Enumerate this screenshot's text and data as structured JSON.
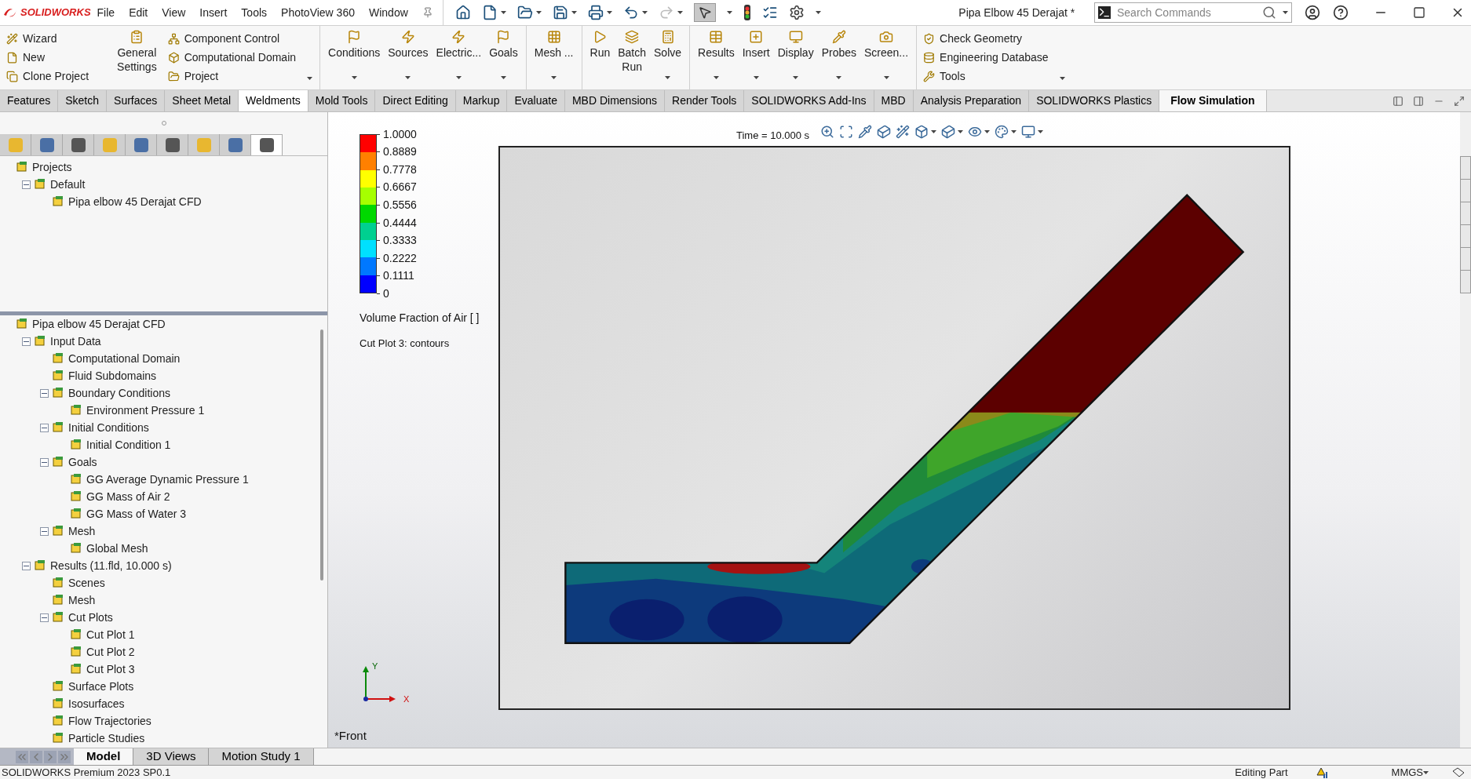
{
  "app": {
    "logo": "SOLIDWORKS",
    "menu": [
      "File",
      "Edit",
      "View",
      "Insert",
      "Tools",
      "PhotoView 360",
      "Window"
    ],
    "title": "Pipa Elbow 45 Derajat *",
    "search": {
      "placeholder": "Search Commands"
    }
  },
  "ribbon": {
    "sections": [
      {
        "groups": [
          {
            "kind": "small",
            "dropdown": false,
            "items": [
              {
                "label": "Wizard"
              },
              {
                "label": "New"
              },
              {
                "label": "Clone Project"
              }
            ]
          },
          {
            "kind": "large",
            "items": [
              {
                "label": "General\nSettings",
                "dropdown": false
              }
            ]
          },
          {
            "kind": "small",
            "dropdown": true,
            "items": [
              {
                "label": "Component Control"
              },
              {
                "label": "Computational Domain"
              },
              {
                "label": "Project"
              }
            ]
          }
        ]
      },
      {
        "groups": [
          {
            "kind": "large",
            "items": [
              {
                "label": "Conditions",
                "dropdown": true
              },
              {
                "label": "Sources",
                "dropdown": true
              },
              {
                "label": "Electric...",
                "dropdown": true
              },
              {
                "label": "Goals",
                "dropdown": true
              }
            ]
          }
        ]
      },
      {
        "groups": [
          {
            "kind": "large",
            "items": [
              {
                "label": "Mesh ...",
                "dropdown": true
              }
            ]
          }
        ]
      },
      {
        "groups": [
          {
            "kind": "large",
            "items": [
              {
                "label": "Run",
                "dropdown": false
              },
              {
                "label": "Batch\nRun",
                "dropdown": false
              },
              {
                "label": "Solve",
                "dropdown": true
              }
            ]
          }
        ]
      },
      {
        "groups": [
          {
            "kind": "large",
            "items": [
              {
                "label": "Results",
                "dropdown": true
              },
              {
                "label": "Insert",
                "dropdown": true
              },
              {
                "label": "Display",
                "dropdown": true
              },
              {
                "label": "Probes",
                "dropdown": true
              },
              {
                "label": "Screen...",
                "dropdown": true
              }
            ]
          }
        ]
      },
      {
        "groups": [
          {
            "kind": "small",
            "dropdown": true,
            "items": [
              {
                "label": "Check Geometry"
              },
              {
                "label": "Engineering Database"
              },
              {
                "label": "Tools"
              }
            ]
          }
        ]
      }
    ]
  },
  "tabs": [
    {
      "label": "Features",
      "selected": false,
      "hovered": false
    },
    {
      "label": "Sketch",
      "selected": false,
      "hovered": false
    },
    {
      "label": "Surfaces",
      "selected": false,
      "hovered": false
    },
    {
      "label": "Sheet Metal",
      "selected": false,
      "hovered": false
    },
    {
      "label": "Weldments",
      "selected": false,
      "hovered": true
    },
    {
      "label": "Mold Tools",
      "selected": false,
      "hovered": false
    },
    {
      "label": "Direct Editing",
      "selected": false,
      "hovered": false
    },
    {
      "label": "Markup",
      "selected": false,
      "hovered": false
    },
    {
      "label": "Evaluate",
      "selected": false,
      "hovered": false
    },
    {
      "label": "MBD Dimensions",
      "selected": false,
      "hovered": false
    },
    {
      "label": "Render Tools",
      "selected": false,
      "hovered": false
    },
    {
      "label": "SOLIDWORKS Add-Ins",
      "selected": false,
      "hovered": false
    },
    {
      "label": "MBD",
      "selected": false,
      "hovered": false
    },
    {
      "label": "Analysis Preparation",
      "selected": false,
      "hovered": false
    },
    {
      "label": "SOLIDWORKS Plastics",
      "selected": false,
      "hovered": false
    },
    {
      "label": "Flow Simulation",
      "selected": true,
      "hovered": false
    }
  ],
  "panel_tabs": [
    {
      "selected": false
    },
    {
      "selected": false
    },
    {
      "selected": false
    },
    {
      "selected": false
    },
    {
      "selected": false
    },
    {
      "selected": false
    },
    {
      "selected": false
    },
    {
      "selected": false
    },
    {
      "selected": true
    }
  ],
  "project_tree": [
    {
      "label": "Projects",
      "children": [
        {
          "label": "Default",
          "expanded": true,
          "children": [
            {
              "label": "Pipa elbow 45 Derajat CFD"
            }
          ]
        }
      ]
    }
  ],
  "analysis_tree": {
    "label": "Pipa elbow 45 Derajat CFD",
    "children": [
      {
        "label": "Input Data",
        "expanded": true,
        "children": [
          {
            "label": "Computational Domain"
          },
          {
            "label": "Fluid Subdomains"
          },
          {
            "label": "Boundary Conditions",
            "expanded": true,
            "children": [
              {
                "label": "Environment Pressure 1"
              }
            ]
          },
          {
            "label": "Initial Conditions",
            "expanded": true,
            "children": [
              {
                "label": "Initial Condition 1"
              }
            ]
          },
          {
            "label": "Goals",
            "expanded": true,
            "children": [
              {
                "label": "GG Average Dynamic Pressure 1"
              },
              {
                "label": "GG Mass of Air 2"
              },
              {
                "label": "GG Mass of Water 3"
              }
            ]
          },
          {
            "label": "Mesh",
            "expanded": true,
            "children": [
              {
                "label": "Global Mesh"
              }
            ]
          }
        ]
      },
      {
        "label": "Results (11.fld, 10.000 s)",
        "expanded": true,
        "children": [
          {
            "label": "Scenes"
          },
          {
            "label": "Mesh"
          },
          {
            "label": "Cut Plots",
            "expanded": true,
            "children": [
              {
                "label": "Cut Plot 1"
              },
              {
                "label": "Cut Plot 2"
              },
              {
                "label": "Cut Plot 3"
              }
            ]
          },
          {
            "label": "Surface Plots"
          },
          {
            "label": "Isosurfaces"
          },
          {
            "label": "Flow Trajectories"
          },
          {
            "label": "Particle Studies"
          }
        ]
      }
    ]
  },
  "viewport": {
    "time": "Time = 10.000 s",
    "legend": {
      "ticks": [
        "1.0000",
        "0.8889",
        "0.7778",
        "0.6667",
        "0.5556",
        "0.4444",
        "0.3333",
        "0.2222",
        "0.1111",
        "0"
      ],
      "bands": [
        {
          "color": "#ff0000"
        },
        {
          "color": "#ff8000"
        },
        {
          "color": "#ffff00"
        },
        {
          "color": "#a6ff00"
        },
        {
          "color": "#00d800"
        },
        {
          "color": "#00d090"
        },
        {
          "color": "#00e0ff"
        },
        {
          "color": "#0078ff"
        },
        {
          "color": "#0000ff"
        }
      ],
      "title": "Volume Fraction of Air [ ]",
      "plot_name": "Cut Plot 3: contours"
    },
    "axes": {
      "y": "Y",
      "x": "X"
    },
    "view_name": "*Front"
  },
  "bottom_tabs": [
    {
      "label": "Model",
      "selected": true
    },
    {
      "label": "3D Views",
      "selected": false
    },
    {
      "label": "Motion Study 1",
      "selected": false
    }
  ],
  "status_bar": {
    "product": "SOLIDWORKS Premium 2023 SP0.1",
    "mode": "Editing Part",
    "units": "MMGS"
  }
}
